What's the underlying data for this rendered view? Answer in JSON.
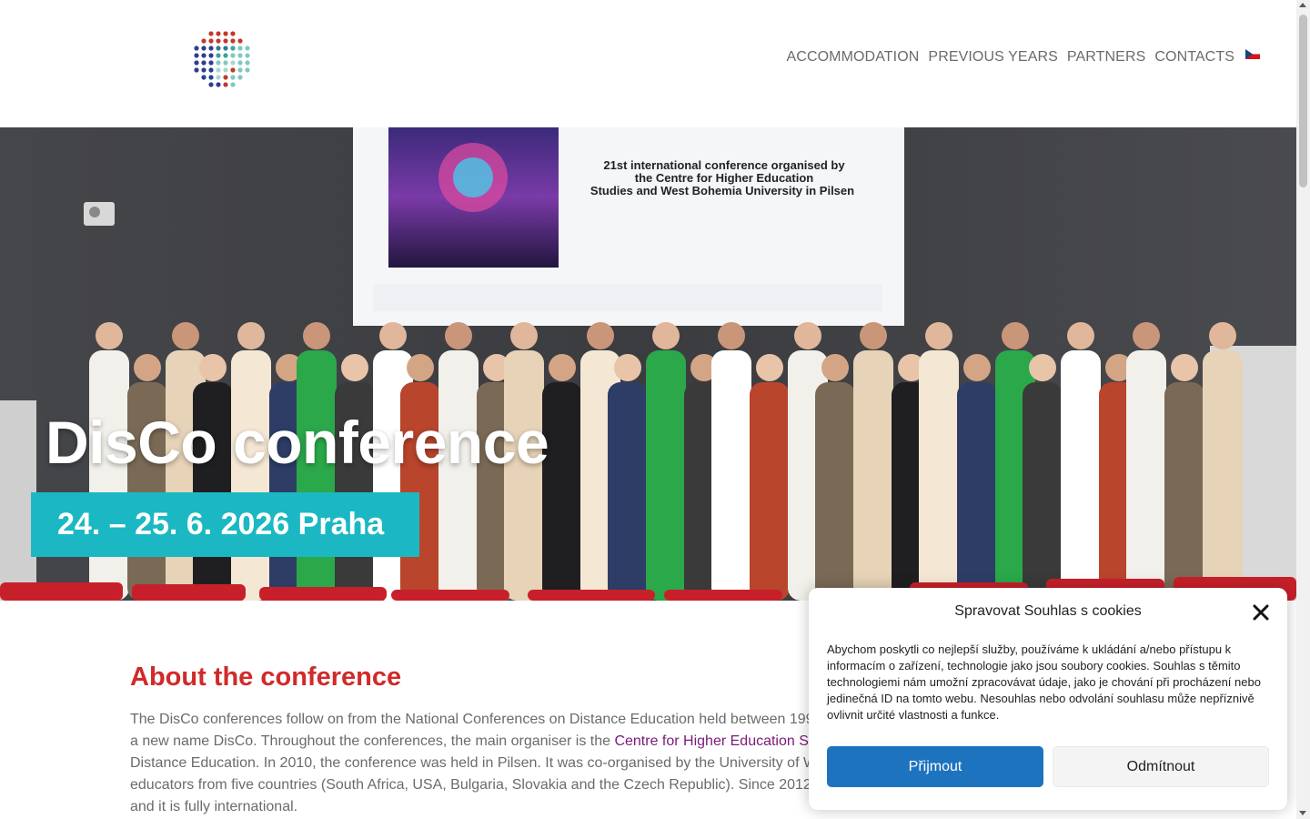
{
  "header": {
    "logo_icon": "dot-grid-logo-icon",
    "nav": [
      {
        "label": "ACCOMMODATION"
      },
      {
        "label": "PREVIOUS YEARS"
      },
      {
        "label": "PARTNERS"
      },
      {
        "label": "CONTACTS"
      }
    ],
    "language_icon": "czech-flag-icon"
  },
  "hero": {
    "title": "DisCo conference",
    "date": "24. – 25. 6. 2026 Praha",
    "screen_text": [
      "21st international conference  organised by",
      "the Centre for Higher Education",
      "Studies  and West Bohemia University in Pilsen"
    ],
    "date_color": "#1bb8c4"
  },
  "about": {
    "title": "About the conference",
    "lines": [
      "The DisCo conferences follow on from the National Conferences on Distance Education held between 199",
      "a new name DisCo. Throughout the conferences, the main organiser is the ",
      "Distance Education. In 2010, the conference was held in Pilsen. It was co-organised by the University of W",
      "educators from five countries (South Africa, USA, Bulgaria, Slovakia and the Czech Republic). Since 2012 w",
      "and it is fully international."
    ],
    "link_text": "Centre for Higher Education S",
    "title_color": "#d12a2a"
  },
  "cookie": {
    "title": "Spravovat Souhlas s cookies",
    "body": "Abychom poskytli co nejlepší služby, používáme k ukládání a/nebo přístupu k informacím o zařízení, technologie jako jsou soubory cookies. Souhlas s těmito technologiemi nám umožní zpracovávat údaje, jako je chování při procházení nebo jedinečná ID na tomto webu. Nesouhlas nebo odvolání souhlasu může nepříznivě ovlivnit určité vlastnosti a funkce.",
    "accept_label": "Přijmout",
    "deny_label": "Odmítnout",
    "close_icon": "close-icon",
    "accent_color": "#1e73be"
  }
}
